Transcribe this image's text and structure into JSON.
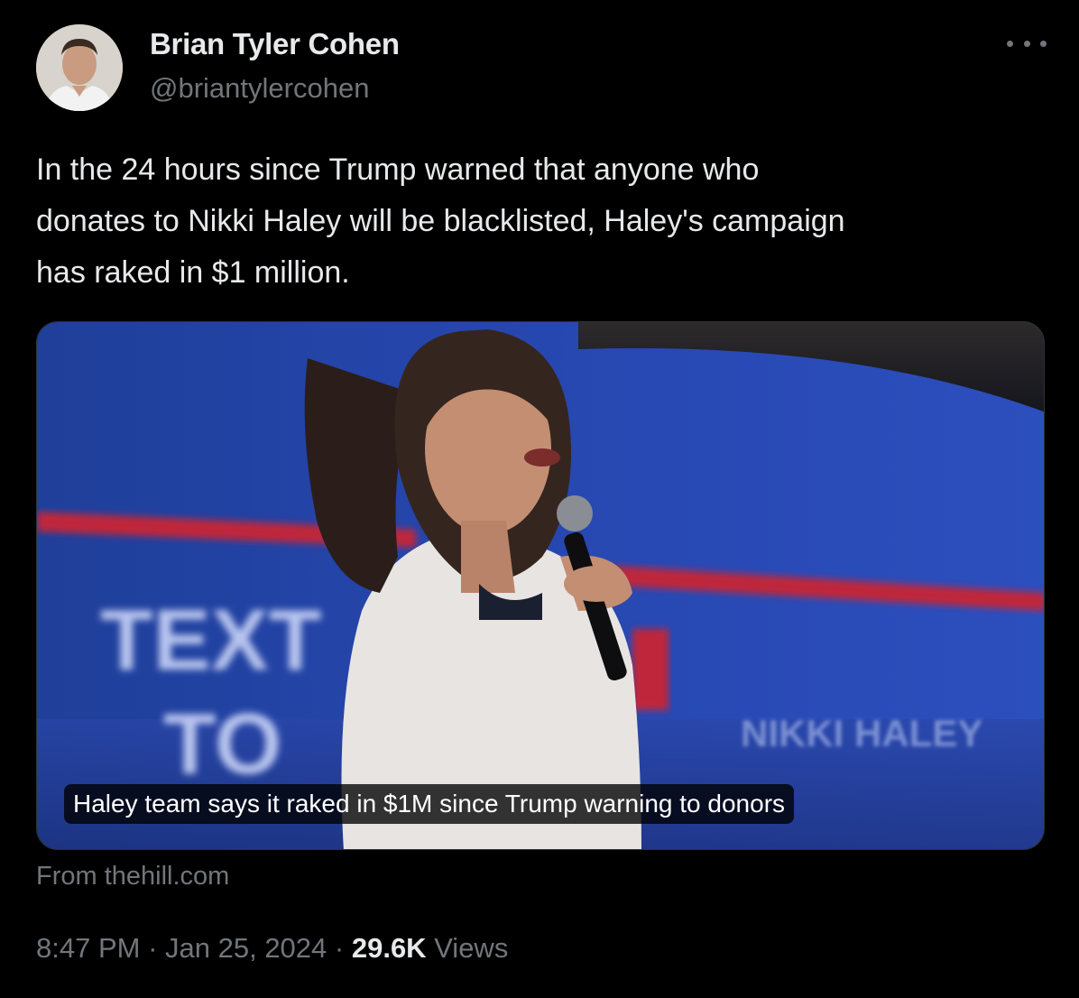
{
  "author": {
    "name": "Brian Tyler Cohen",
    "handle": "@briantylercohen"
  },
  "tweet": {
    "text": "In the 24 hours since Trump warned that anyone who\ndonates to Nikki Haley will be blacklisted, Haley's campaign\nhas raked in $1 million."
  },
  "card": {
    "caption": "Haley team says it raked in $1M since Trump warning to donors",
    "source": "From thehill.com",
    "image_sign_text": "TEXT",
    "image_sign_text_2": "TO",
    "image_banner_text": "NIKKI HALEY"
  },
  "meta": {
    "time": "8:47 PM",
    "separator": " · ",
    "date": "Jan 25, 2024",
    "views_count": "29.6K",
    "views_label": " Views"
  },
  "icons": {
    "more": "more-horizontal-icon"
  },
  "colors": {
    "background": "#000000",
    "text_primary": "#e7e9ea",
    "text_secondary": "#71767b",
    "border": "#2f3336"
  }
}
